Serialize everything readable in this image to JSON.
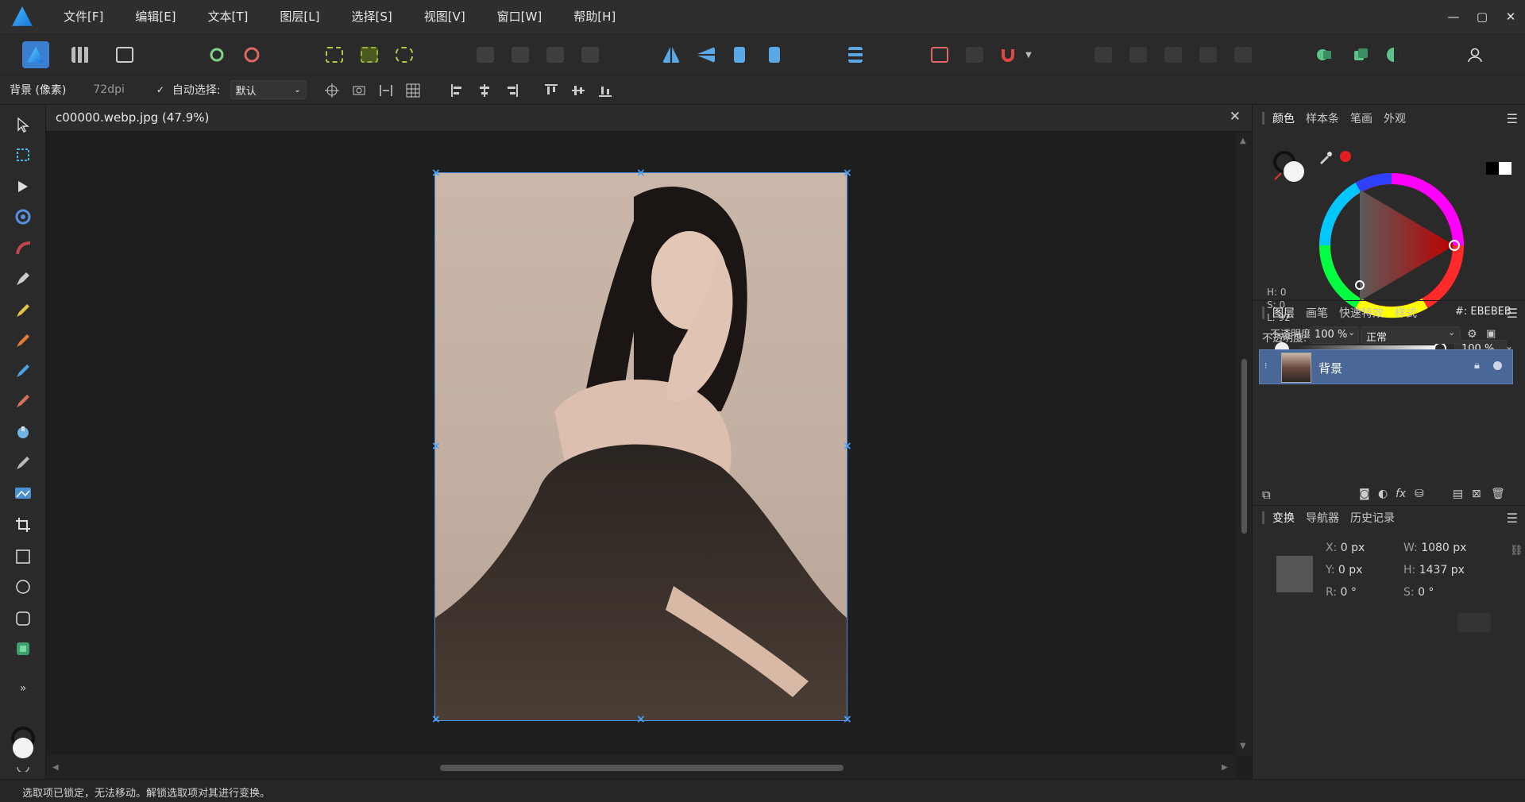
{
  "menubar": {
    "items": [
      "文件[F]",
      "编辑[E]",
      "文本[T]",
      "图层[L]",
      "选择[S]",
      "视图[V]",
      "窗口[W]",
      "帮助[H]"
    ]
  },
  "context": {
    "layer_label": "背景 (像素)",
    "dpi": "72dpi",
    "auto_select_label": "自动选择:",
    "auto_select_value": "默认"
  },
  "document": {
    "tab_title": "c00000.webp.jpg (47.9%)"
  },
  "status": {
    "message": "选取项已锁定，无法移动。解锁选取项对其进行变换。"
  },
  "color_panel": {
    "tabs": [
      "颜色",
      "样本条",
      "笔画",
      "外观"
    ],
    "h": "H: 0",
    "s": "S: 0",
    "l": "L: 92",
    "hex": "#: EBEBEB",
    "opacity_label": "不透明度",
    "opacity_value": "100 %"
  },
  "layers_panel": {
    "tabs": [
      "图层",
      "画笔",
      "快速特效",
      "样式"
    ],
    "opacity_label": "不透明度:",
    "opacity_value": "100 %",
    "blend_mode": "正常",
    "layer_name": "背景"
  },
  "transform_panel": {
    "tabs": [
      "变换",
      "导航器",
      "历史记录"
    ],
    "x_label": "X:",
    "x_value": "0 px",
    "y_label": "Y:",
    "y_value": "0 px",
    "w_label": "W:",
    "w_value": "1080 px",
    "h_label": "H:",
    "h_value": "1437 px",
    "r_label": "R:",
    "r_value": "0 °",
    "s_label": "S:",
    "s_value": "0 °"
  },
  "colors": {
    "accent": "#4a90e2",
    "layer_selected": "#4a6897",
    "panel_bg": "#2a2a2a"
  }
}
